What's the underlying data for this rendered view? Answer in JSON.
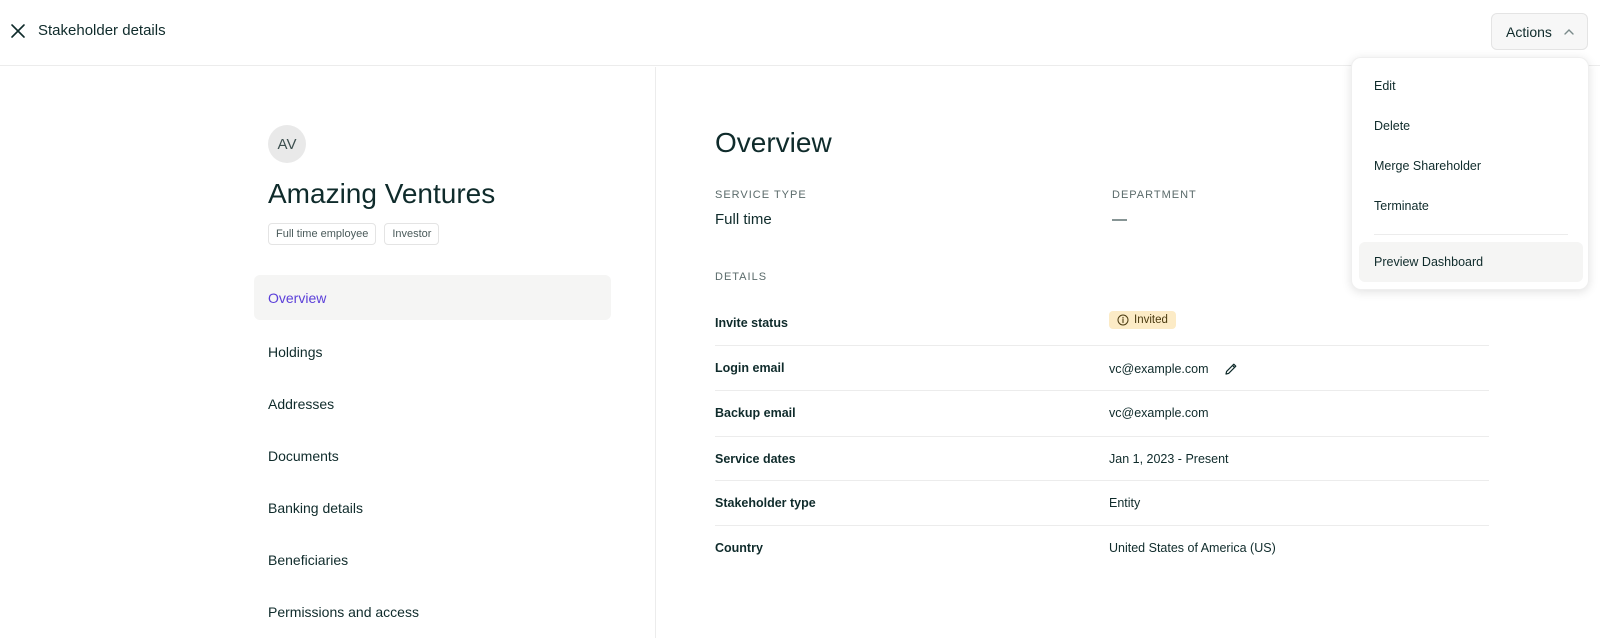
{
  "header": {
    "title": "Stakeholder details",
    "actions_label": "Actions"
  },
  "profile": {
    "initials": "AV",
    "name": "Amazing Ventures",
    "tags": [
      "Full time employee",
      "Investor"
    ]
  },
  "nav": {
    "items": [
      {
        "label": "Overview",
        "active": true
      },
      {
        "label": "Holdings"
      },
      {
        "label": "Addresses"
      },
      {
        "label": "Documents"
      },
      {
        "label": "Banking details"
      },
      {
        "label": "Beneficiaries"
      },
      {
        "label": "Permissions and access"
      }
    ]
  },
  "overview": {
    "title": "Overview",
    "service_type_label": "SERVICE TYPE",
    "service_type_value": "Full time",
    "department_label": "DEPARTMENT",
    "department_value": "—",
    "details_label": "DETAILS",
    "rows": [
      {
        "key": "Invite status",
        "value": "Invited"
      },
      {
        "key": "Login email",
        "value": "vc@example.com"
      },
      {
        "key": "Backup email",
        "value": "vc@example.com"
      },
      {
        "key": "Service dates",
        "value": "Jan 1, 2023 - Present"
      },
      {
        "key": "Stakeholder type",
        "value": "Entity"
      },
      {
        "key": "Country",
        "value": "United States of America (US)"
      }
    ]
  },
  "menu": {
    "items": [
      "Edit",
      "Delete",
      "Merge Shareholder",
      "Terminate"
    ],
    "preview": "Preview Dashboard"
  },
  "colors": {
    "accent": "#5b3fd9",
    "badge_bg": "#fcebc6",
    "text": "#0f2b2b"
  },
  "icons": [
    "close-icon",
    "chevron-up-icon",
    "info-circle-icon",
    "pencil-icon"
  ]
}
